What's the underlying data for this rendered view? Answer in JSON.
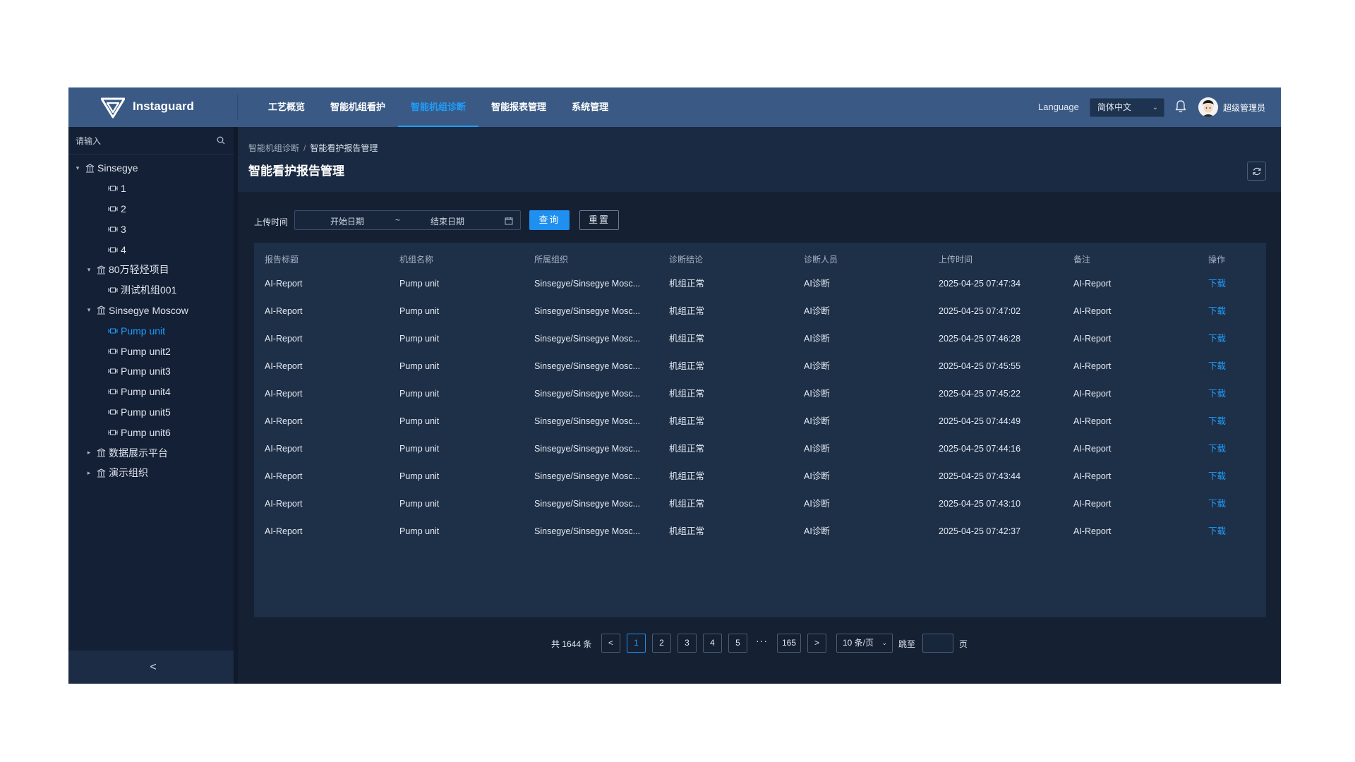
{
  "header": {
    "brand": "Instaguard",
    "nav": [
      "工艺概览",
      "智能机组看护",
      "智能机组诊断",
      "智能报表管理",
      "系统管理"
    ],
    "nav_active": "智能机组诊断",
    "language_label": "Language",
    "language_value": "简体中文",
    "username": "超级管理员"
  },
  "sidebar": {
    "search_placeholder": "请输入",
    "tree": [
      {
        "label": "Sinsegye",
        "icon": "org-icon",
        "caret": "expanded"
      },
      {
        "label": "1",
        "icon": "unit-icon",
        "caret": "none"
      },
      {
        "label": "2",
        "icon": "unit-icon",
        "caret": "none"
      },
      {
        "label": "3",
        "icon": "unit-icon",
        "caret": "none"
      },
      {
        "label": "4",
        "icon": "unit-icon",
        "caret": "none"
      },
      {
        "label": "80万轻烃项目",
        "icon": "org-icon",
        "caret": "expanded"
      },
      {
        "label": "测试机组001",
        "icon": "unit-icon",
        "caret": "none"
      },
      {
        "label": "Sinsegye Moscow",
        "icon": "org-icon",
        "caret": "expanded"
      },
      {
        "label": "Pump unit",
        "icon": "unit-icon",
        "caret": "none",
        "selected": true
      },
      {
        "label": "Pump unit2",
        "icon": "unit-icon",
        "caret": "none"
      },
      {
        "label": "Pump unit3",
        "icon": "unit-icon",
        "caret": "none"
      },
      {
        "label": "Pump unit4",
        "icon": "unit-icon",
        "caret": "none"
      },
      {
        "label": "Pump unit5",
        "icon": "unit-icon",
        "caret": "none"
      },
      {
        "label": "Pump unit6",
        "icon": "unit-icon",
        "caret": "none"
      },
      {
        "label": "数据展示平台",
        "icon": "org-icon",
        "caret": "collapsed"
      },
      {
        "label": "演示组织",
        "icon": "org-icon",
        "caret": "collapsed"
      }
    ],
    "collapse_label": "<"
  },
  "breadcrumb": {
    "parent": "智能机组诊断",
    "separator": "/",
    "current": "智能看护报告管理"
  },
  "page_title": "智能看护报告管理",
  "filter": {
    "label": "上传时间",
    "start_placeholder": "开始日期",
    "separator": "~",
    "end_placeholder": "结束日期",
    "query_label": "查询",
    "reset_label": "重置"
  },
  "table": {
    "columns": [
      "报告标题",
      "机组名称",
      "所属组织",
      "诊断结论",
      "诊断人员",
      "上传时间",
      "备注",
      "操作"
    ],
    "rows": [
      [
        "AI-Report",
        "Pump unit",
        "Sinsegye/Sinsegye Mosc...",
        "机组正常",
        "AI诊断",
        "2025-04-25 07:47:34",
        "AI-Report",
        "下载"
      ],
      [
        "AI-Report",
        "Pump unit",
        "Sinsegye/Sinsegye Mosc...",
        "机组正常",
        "AI诊断",
        "2025-04-25 07:47:02",
        "AI-Report",
        "下载"
      ],
      [
        "AI-Report",
        "Pump unit",
        "Sinsegye/Sinsegye Mosc...",
        "机组正常",
        "AI诊断",
        "2025-04-25 07:46:28",
        "AI-Report",
        "下载"
      ],
      [
        "AI-Report",
        "Pump unit",
        "Sinsegye/Sinsegye Mosc...",
        "机组正常",
        "AI诊断",
        "2025-04-25 07:45:55",
        "AI-Report",
        "下载"
      ],
      [
        "AI-Report",
        "Pump unit",
        "Sinsegye/Sinsegye Mosc...",
        "机组正常",
        "AI诊断",
        "2025-04-25 07:45:22",
        "AI-Report",
        "下载"
      ],
      [
        "AI-Report",
        "Pump unit",
        "Sinsegye/Sinsegye Mosc...",
        "机组正常",
        "AI诊断",
        "2025-04-25 07:44:49",
        "AI-Report",
        "下载"
      ],
      [
        "AI-Report",
        "Pump unit",
        "Sinsegye/Sinsegye Mosc...",
        "机组正常",
        "AI诊断",
        "2025-04-25 07:44:16",
        "AI-Report",
        "下载"
      ],
      [
        "AI-Report",
        "Pump unit",
        "Sinsegye/Sinsegye Mosc...",
        "机组正常",
        "AI诊断",
        "2025-04-25 07:43:44",
        "AI-Report",
        "下载"
      ],
      [
        "AI-Report",
        "Pump unit",
        "Sinsegye/Sinsegye Mosc...",
        "机组正常",
        "AI诊断",
        "2025-04-25 07:43:10",
        "AI-Report",
        "下载"
      ],
      [
        "AI-Report",
        "Pump unit",
        "Sinsegye/Sinsegye Mosc...",
        "机组正常",
        "AI诊断",
        "2025-04-25 07:42:37",
        "AI-Report",
        "下载"
      ]
    ]
  },
  "pagination": {
    "total_text": "共 1644 条",
    "prev": "<",
    "pages": [
      "1",
      "2",
      "3",
      "4",
      "5"
    ],
    "current_page": "1",
    "ellipsis": "···",
    "last_page": "165",
    "next": ">",
    "page_size": "10 条/页",
    "goto_label": "跳至",
    "page_suffix": "页"
  },
  "colors": {
    "topbar": "#3a5a85",
    "background": "#152033",
    "accent": "#1f9dfb",
    "table_bg": "#1e2f48"
  }
}
